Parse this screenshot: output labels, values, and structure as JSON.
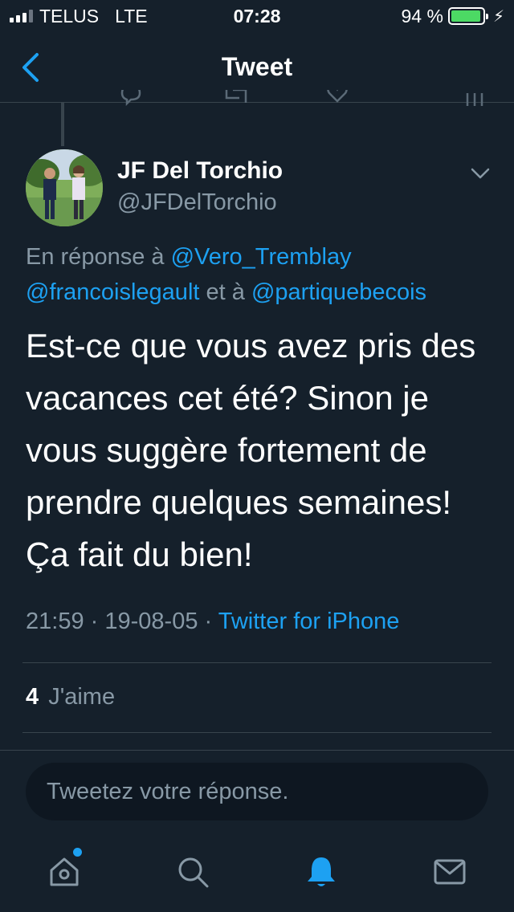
{
  "status_bar": {
    "carrier": "TELUS",
    "network": "LTE",
    "time": "07:28",
    "battery_percent": "94 %",
    "battery_level": 0.94,
    "battery_color": "#4cd964"
  },
  "nav": {
    "title": "Tweet",
    "back_icon": "chevron-left-icon"
  },
  "tweet": {
    "author_name": "JF Del Torchio",
    "author_handle": "@JFDelTorchio",
    "reply_prefix": "En réponse à",
    "mention_1": "@Vero_Tremblay",
    "mention_2": "@francoislegault",
    "reply_connector": "et à",
    "mention_3": "@partiquebecois",
    "text_lines": [
      "Est-ce que vous avez pris des",
      "vacances cet été? Sinon je",
      "vous suggère fortement de",
      "prendre quelques semaines!",
      "Ça fait du bien!"
    ],
    "time": "21:59",
    "date": "19-08-05",
    "separator": "·",
    "source": "Twitter for iPhone",
    "likes_count": "4",
    "likes_label": "J'aime"
  },
  "reply_input": {
    "placeholder": "Tweetez votre réponse."
  },
  "tab_bar": {
    "items": [
      "home-icon",
      "search-icon",
      "notifications-icon",
      "messages-icon"
    ],
    "active": "notifications-icon"
  },
  "colors": {
    "background": "#15202b",
    "accent": "#1da1f2",
    "muted": "#8899a6",
    "divider": "#38444d"
  }
}
